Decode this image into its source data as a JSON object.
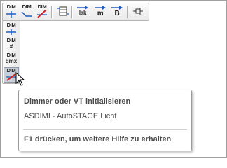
{
  "toolbar": {
    "buttons": [
      {
        "label": "DIM",
        "icon": "dimmer-add-icon"
      },
      {
        "label": "DIM",
        "icon": "dimmer-curve-icon"
      },
      {
        "label": "DIM",
        "icon": "dimmer-remove-icon"
      },
      {
        "label": "",
        "icon": "circuit-table-icon"
      },
      {
        "label": "lak",
        "icon": "laser-arrow-icon"
      },
      {
        "label": "m",
        "icon": "meter-arrow-icon"
      },
      {
        "label": "B",
        "icon": "beam-arrow-icon"
      },
      {
        "label": "",
        "icon": "pin-icon"
      }
    ]
  },
  "vertical_toolbar": {
    "buttons": [
      {
        "label": "DIM",
        "sub": "",
        "icon": "dimmer-insert-icon"
      },
      {
        "label": "DIM",
        "sub": "#",
        "icon": "dimmer-number-icon"
      },
      {
        "label": "DIM",
        "sub": "dmx",
        "icon": "dimmer-dmx-icon"
      },
      {
        "label": "DIM",
        "sub": "",
        "icon": "dimmer-initialize-icon"
      }
    ]
  },
  "tooltip": {
    "title": "Dimmer oder VT initialisieren",
    "description": "ASDIMI - AutoSTAGE Licht",
    "help": "F1 drücken, um weitere Hilfe zu erhalten"
  },
  "colors": {
    "accent_blue": "#1f5fbf",
    "accent_red": "#d42020"
  }
}
